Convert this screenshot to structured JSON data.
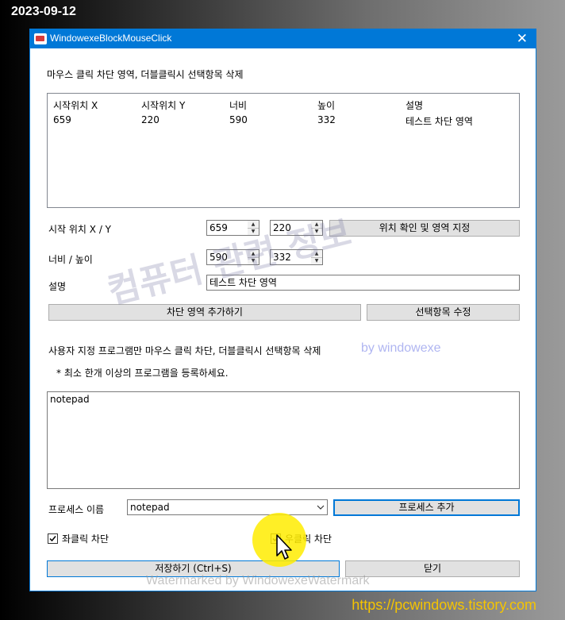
{
  "overlay": {
    "date": "2023-09-12",
    "site_url": "https://pcwindows.tistory.com"
  },
  "window": {
    "title": "WindowexeBlockMouseClick",
    "close_glyph": "✕"
  },
  "section1": {
    "heading": "마우스 클릭 차단 영역, 더블클릭시 선택항목 삭제",
    "list": {
      "columns": [
        "시작위치 X",
        "시작위치 Y",
        "너비",
        "높이",
        "설명"
      ],
      "rows": [
        [
          "659",
          "220",
          "590",
          "332",
          "테스트 차단 영역"
        ]
      ]
    }
  },
  "form": {
    "start_pos_label": "시작 위치 X / Y",
    "start_x": "659",
    "start_y": "220",
    "locate_button": "위치 확인 및 영역 지정",
    "size_label": "너비 / 높이",
    "width": "590",
    "height": "332",
    "desc_label": "설명",
    "desc_value": "테스트 차단 영역",
    "add_area_button": "차단 영역 추가하기",
    "edit_selected_button": "선택항목 수정"
  },
  "section2": {
    "heading": "사용자 지정 프로그램만 마우스 클릭 차단, 더블클릭시 선택항목 삭제",
    "note": "* 최소 한개 이상의 프로그램을 등록하세요.",
    "programs_text": "notepad",
    "process_label": "프로세스 이름",
    "process_value": "notepad",
    "add_process_button": "프로세스 추가"
  },
  "options": {
    "left_click_label": "좌클릭 차단",
    "left_click_checked": true,
    "right_click_label": "우클릭 차단",
    "right_click_checked": true
  },
  "footer": {
    "save_button": "저장하기 (Ctrl+S)",
    "close_button": "닫기"
  },
  "watermarks": {
    "big": "컴퓨터 관련 정보",
    "by": "by windowexe",
    "bottom": "Watermarked by WindowexeWatermark"
  },
  "colors": {
    "titlebar": "#0078d7",
    "site_url": "#f5c400",
    "highlight": "#ffec00"
  },
  "icons": {
    "close": "close-icon",
    "app": "app-icon",
    "dropdown": "chevron-down-icon",
    "check": "checkmark-icon",
    "cursor": "mouse-pointer-icon"
  }
}
